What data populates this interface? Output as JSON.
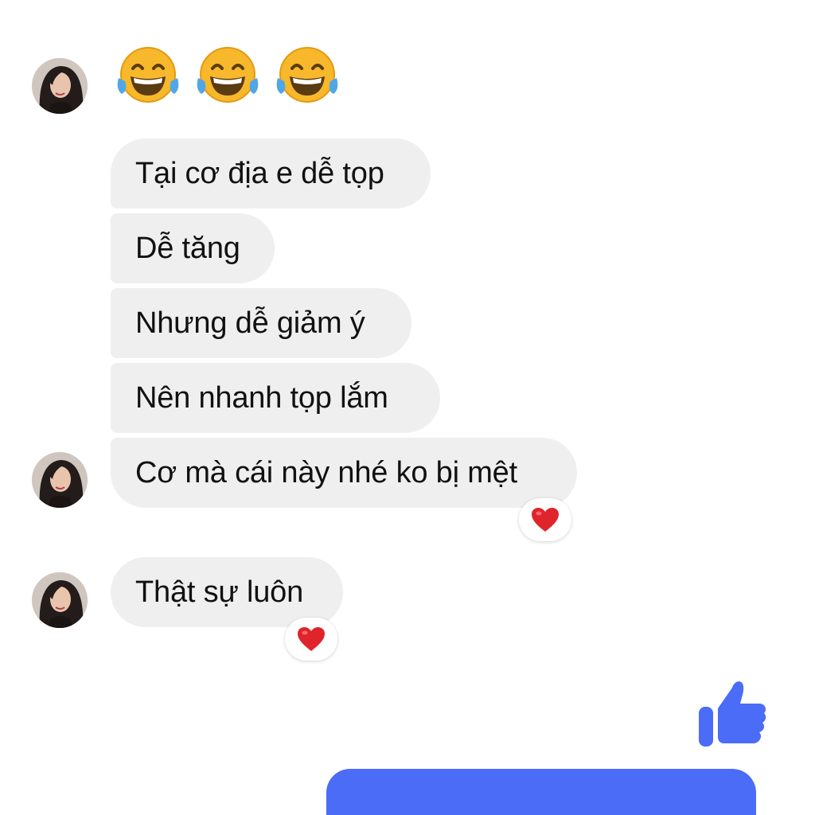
{
  "chat": {
    "emoji_message": [
      "face-with-tears-of-joy",
      "face-with-tears-of-joy",
      "face-with-tears-of-joy"
    ],
    "messages": [
      {
        "text": "Tại cơ địa e dễ tọp"
      },
      {
        "text": "Dễ tăng"
      },
      {
        "text": "Nhưng dễ giảm ý"
      },
      {
        "text": "Nên nhanh tọp lắm"
      },
      {
        "text": "Cơ mà cái này nhé ko bị mệt",
        "reaction": "heart"
      },
      {
        "text": "Thật sự luôn",
        "reaction": "heart"
      }
    ],
    "sent_like": "thumbs-up-icon"
  },
  "colors": {
    "incoming_bubble": "#efefef",
    "text": "#111111",
    "accent_blue": "#4a6cf7",
    "heart_red": "#e0242b",
    "emoji_yellow": "#f7b82b"
  }
}
